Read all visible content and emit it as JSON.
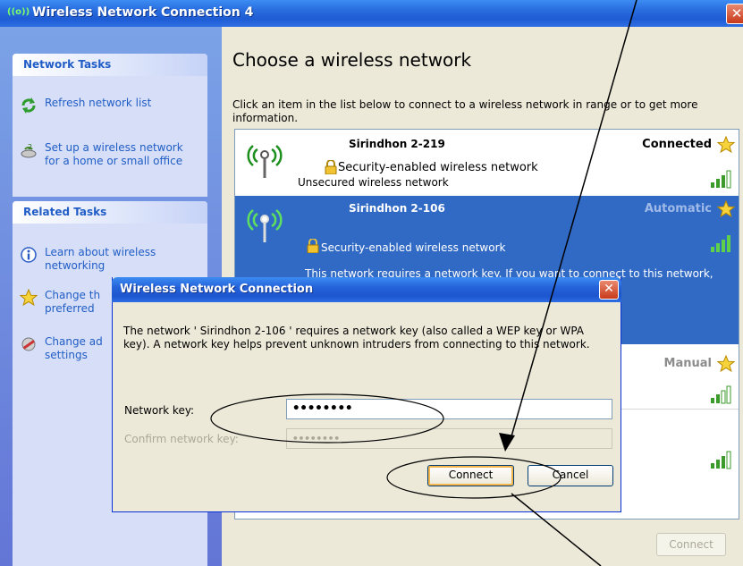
{
  "main_window": {
    "title": "Wireless Network Connection 4",
    "title_icon": "((o))",
    "close_glyph": "✕",
    "heading": "Choose a wireless network",
    "instructions": "Click an item in the list below to connect to a wireless network in range or to get more information.",
    "connect_button": "Connect"
  },
  "network_tasks": {
    "header": "Network Tasks",
    "items": [
      {
        "label": "Refresh network list",
        "icon": "refresh-icon"
      },
      {
        "label": "Set up a wireless network\nfor a home or small office",
        "icon": "setup-wizard-icon"
      }
    ]
  },
  "related_tasks": {
    "header": "Related Tasks",
    "items": [
      {
        "label": "Learn about wireless\nnetworking",
        "icon": "info-icon"
      },
      {
        "label": "Change th\npreferred",
        "icon": "star-icon"
      },
      {
        "label": "Change ad\nsettings",
        "icon": "settings-icon"
      }
    ]
  },
  "networks": [
    {
      "name": "Sirindhon 2-219",
      "status": "Connected",
      "security": "Security-enabled wireless network",
      "sub": "Unsecured wireless network"
    },
    {
      "name": "Sirindhon 2-106",
      "status": "Automatic",
      "security": "Security-enabled wireless network",
      "note": "This network requires a network key. If you want to connect to this network,"
    },
    {
      "status": "Manual"
    },
    {
      "status": ""
    }
  ],
  "dialog": {
    "title": "Wireless Network Connection",
    "message": "The network ' Sirindhon 2-106 ' requires a network key (also called a WEP key or WPA key). A network key helps prevent unknown intruders from connecting to this network.",
    "network_key_label": "Network key:",
    "network_key_value": "••••••••",
    "confirm_label": "Confirm network key:",
    "confirm_value": "••••••••",
    "connect_button": "Connect",
    "cancel_button": "Cancel"
  },
  "colors": {
    "titlebar": "#2563da",
    "selection": "#316ac5",
    "task_pane": "#6e8ddd",
    "annotation": "#000000"
  }
}
